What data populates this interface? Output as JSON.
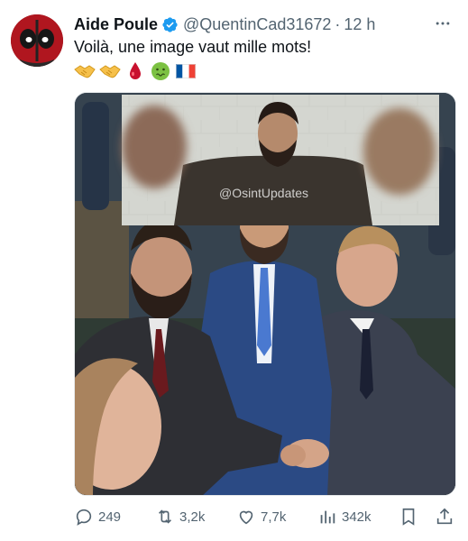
{
  "post": {
    "author": {
      "display_name": "Aide Poule",
      "handle": "@QuentinCad31672",
      "verified": true,
      "avatar_icon": "deadpool-avatar"
    },
    "separator": "·",
    "time": "12 h",
    "more_icon": "more-horizontal-icon",
    "text": "Voilà, une image vaut mille mots!",
    "emojis": [
      "handshake",
      "handshake",
      "drop-of-blood",
      "nauseated-face",
      "flag-france"
    ],
    "media": {
      "inset_watermark": "@OsintUpdates"
    },
    "actions": {
      "replies": "249",
      "reposts": "3,2k",
      "likes": "7,7k",
      "views": "342k"
    }
  },
  "colors": {
    "text": "#0f1419",
    "secondary": "#536471",
    "verified": "#1d9bf0"
  }
}
